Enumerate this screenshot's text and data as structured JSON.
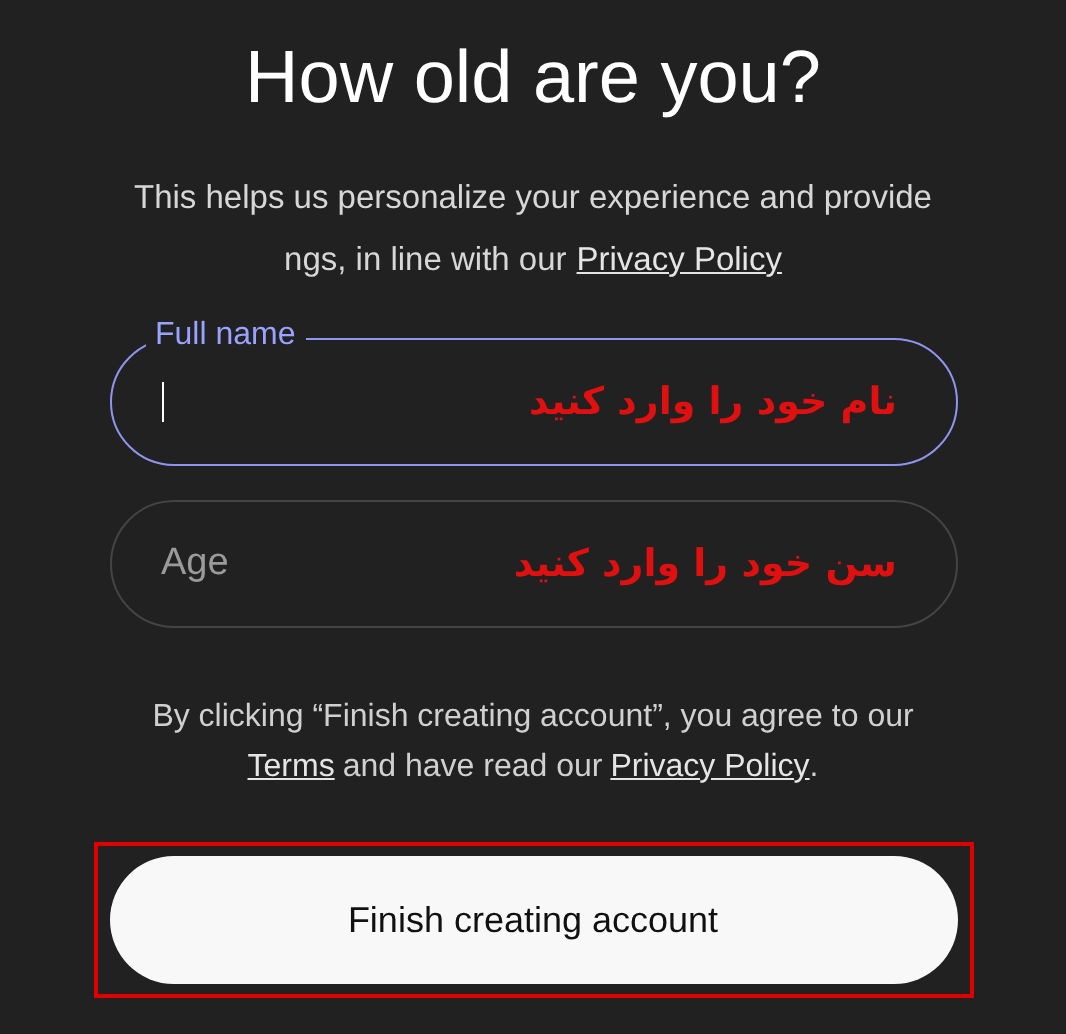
{
  "title": "How old are you?",
  "description": {
    "line_1": "This helps us personalize your experience and provide",
    "line_2": "ngs, in line with our",
    "link": "Privacy Policy"
  },
  "fields": [
    {
      "label": "Full name",
      "focused": true,
      "annotation": "نام خود را وارد کنید"
    },
    {
      "label": "Age",
      "focused": false,
      "annotation": "سن خود را وارد کنید"
    }
  ],
  "legal": {
    "text_1": "By clicking “Finish creating account”, you agree to our",
    "terms_link": "Terms",
    "text_2": "and have read our",
    "privacy_link": "Privacy Policy",
    "text_3": "."
  },
  "submit_button": {
    "label": "Finish creating account",
    "highlighted": true
  }
}
